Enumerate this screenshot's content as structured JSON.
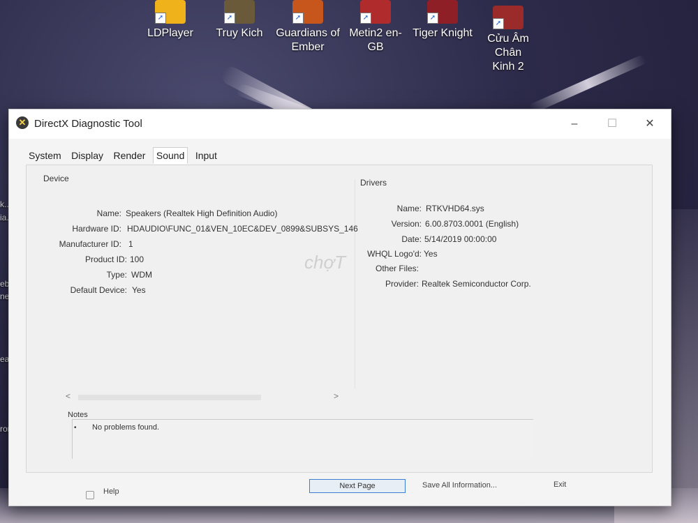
{
  "desktop": {
    "icons": [
      {
        "label1": "LDPlayer",
        "label2": "",
        "color": "#f0b21a",
        "glyph": "▶"
      },
      {
        "label1": "Truy Kich",
        "label2": "",
        "color": "#8a6d3b",
        "glyph": "✦"
      },
      {
        "label1": "Guardians of",
        "label2": "Ember",
        "color": "#c7561d",
        "glyph": "G"
      },
      {
        "label1": "Metin2 en-GB",
        "label2": "",
        "color": "#b02c2c",
        "glyph": "M"
      },
      {
        "label1": "Tiger Knight",
        "label2": "",
        "color": "#8e1f26",
        "glyph": "虎"
      },
      {
        "label1": "Cửu Âm Chân",
        "label2": "Kinh 2",
        "color": "#9b2a2a",
        "glyph": "⚔"
      }
    ],
    "left_edge": {
      "t1": "k...",
      "t2": "ia...",
      "t3": "ebky...",
      "t4": "nem...",
      "t5": "eam",
      "t6": "romium"
    }
  },
  "window": {
    "title": "DirectX Diagnostic Tool",
    "app_icon": "directx-x-icon",
    "controls": {
      "minimize": "–",
      "maximize": "☐",
      "close": "✕"
    },
    "tabs": [
      "System",
      "Display",
      "Render",
      "Sound",
      "Input"
    ],
    "active_tab": "Sound",
    "device": {
      "group_label": "Device",
      "fields": [
        {
          "label": "Name:",
          "value": "Speakers (Realtek High Definition Audio)"
        },
        {
          "label": "Hardware ID:",
          "value": "HDAUDIO\\FUNC_01&VEN_10EC&DEV_0899&SUBSYS_146"
        },
        {
          "label": "Manufacturer ID:",
          "value": "1"
        },
        {
          "label": "Product ID:",
          "value": "100"
        },
        {
          "label": "Type:",
          "value": "WDM"
        },
        {
          "label": "Default Device:",
          "value": "Yes"
        }
      ]
    },
    "drivers": {
      "group_label": "Drivers",
      "fields": [
        {
          "label": "Name:",
          "value": "RTKVHD64.sys"
        },
        {
          "label": "Version:",
          "value": "6.00.8703.0001 (English)"
        },
        {
          "label": "Date:",
          "value": "5/14/2019 00:00:00"
        },
        {
          "label": "WHQL Logo'd:",
          "value": "Yes"
        },
        {
          "label": "Other Files:",
          "value": ""
        },
        {
          "label": "Provider:",
          "value": "Realtek Semiconductor Corp."
        }
      ]
    },
    "scroll": {
      "left": "<",
      "right": ">"
    },
    "notes": {
      "label": "Notes",
      "bullet": "•",
      "text": "No problems found."
    },
    "footer": {
      "help": "Help",
      "next_page": "Next Page",
      "save_all": "Save All Information...",
      "exit": "Exit"
    },
    "watermark": "chợT"
  }
}
